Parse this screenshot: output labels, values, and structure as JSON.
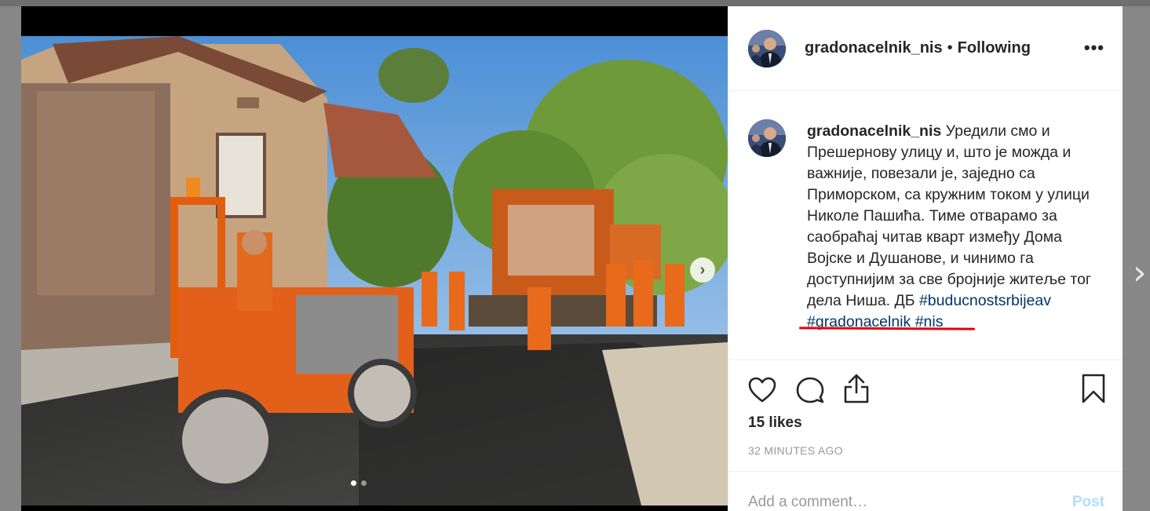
{
  "post": {
    "username": "gradonacelnik_nis",
    "separator": "•",
    "follow_status": "Following",
    "more_label": "•••",
    "caption_user": "gradonacelnik_nis",
    "caption_body": "Уредили смо и Прешернову улицу и, што је можда и важније, повезали је, заједно са Приморском, са кружним током у улици Николе Пашића. Тиме отварамо за саобраћај  читав кварт између Дома Војске и Душанове, и чинимо га доступнијим за све бројније житеље тог дела Ниша. ДБ",
    "hashtags": [
      "#buducnostsrbijeav",
      "#gradonacelnik",
      "#nis"
    ],
    "likes": "15 likes",
    "time_ago": "32 MINUTES AGO",
    "comment_placeholder": "Add a comment…",
    "post_button": "Post",
    "media_page": {
      "current": 1,
      "total": 2
    }
  },
  "icons": {
    "heart": "heart-icon",
    "comment": "comment-icon",
    "share": "share-icon",
    "bookmark": "bookmark-icon",
    "next": "chevron-right-icon"
  },
  "colors": {
    "hashtag": "#003569",
    "post_button": "#b3dbff",
    "annotation_underline": "#e3000f"
  }
}
